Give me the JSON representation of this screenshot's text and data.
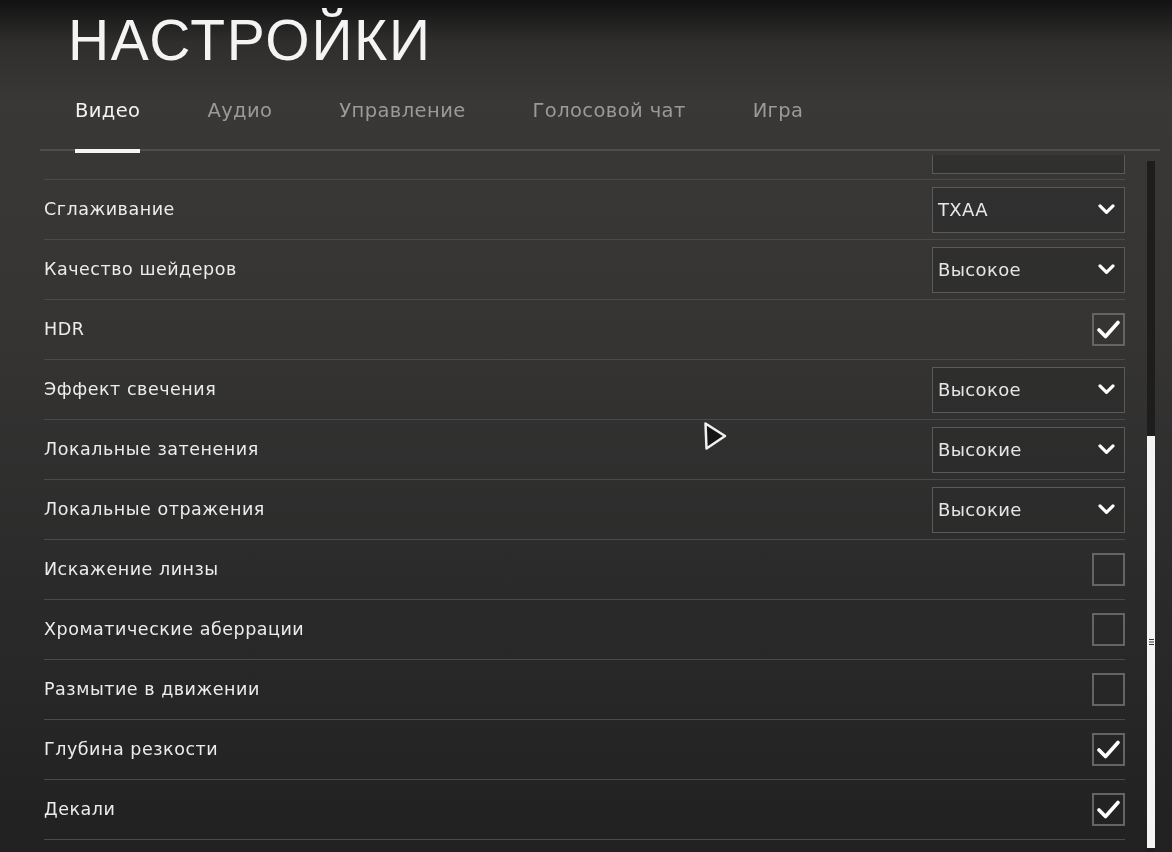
{
  "title": "НАСТРОЙКИ",
  "tabs": [
    {
      "label": "Видео",
      "selected": true
    },
    {
      "label": "Аудио",
      "selected": false
    },
    {
      "label": "Управление",
      "selected": false
    },
    {
      "label": "Голосовой чат",
      "selected": false
    },
    {
      "label": "Игра",
      "selected": false
    }
  ],
  "settings": [
    {
      "kind": "dropdown",
      "label": "Сглаживание",
      "value": "TXAA"
    },
    {
      "kind": "dropdown",
      "label": "Качество шейдеров",
      "value": "Высокое"
    },
    {
      "kind": "checkbox",
      "label": "HDR",
      "checked": true
    },
    {
      "kind": "dropdown",
      "label": "Эффект свечения",
      "value": "Высокое"
    },
    {
      "kind": "dropdown",
      "label": "Локальные затенения",
      "value": "Высокие"
    },
    {
      "kind": "dropdown",
      "label": "Локальные отражения",
      "value": "Высокие"
    },
    {
      "kind": "checkbox",
      "label": "Искажение линзы",
      "checked": false
    },
    {
      "kind": "checkbox",
      "label": "Хроматические аберрации",
      "checked": false
    },
    {
      "kind": "checkbox",
      "label": "Размытие в движении",
      "checked": false
    },
    {
      "kind": "checkbox",
      "label": "Глубина резкости",
      "checked": true
    },
    {
      "kind": "checkbox",
      "label": "Декали",
      "checked": true
    }
  ]
}
